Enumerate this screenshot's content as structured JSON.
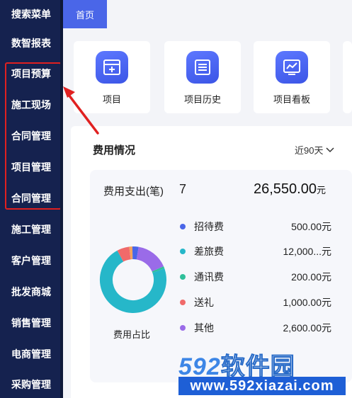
{
  "sidebar": {
    "items": [
      {
        "label": "搜索菜单"
      },
      {
        "label": "数智报表"
      },
      {
        "label": "项目预算"
      },
      {
        "label": "施工现场"
      },
      {
        "label": "合同管理"
      },
      {
        "label": "项目管理"
      },
      {
        "label": "合同管理"
      },
      {
        "label": "施工管理"
      },
      {
        "label": "客户管理"
      },
      {
        "label": "批发商城"
      },
      {
        "label": "销售管理"
      },
      {
        "label": "电商管理"
      },
      {
        "label": "采购管理"
      }
    ]
  },
  "topbar": {
    "home_tab": "首页"
  },
  "quick_cards": [
    {
      "label": "项目",
      "icon": "project-add-icon"
    },
    {
      "label": "项目历史",
      "icon": "project-history-icon"
    },
    {
      "label": "项目看板",
      "icon": "project-dashboard-icon"
    }
  ],
  "expenses": {
    "title": "费用情况",
    "period": "近90天",
    "count_label": "费用支出(笔)",
    "count": "7",
    "total": "26,550.00",
    "total_unit": "元",
    "donut_caption": "费用占比",
    "items": [
      {
        "name": "招待费",
        "amount": "500.00元",
        "color": "#4a66e8"
      },
      {
        "name": "差旅费",
        "amount": "12,000...元",
        "color": "#26b7c9"
      },
      {
        "name": "通讯费",
        "amount": "200.00元",
        "color": "#2fbf9a"
      },
      {
        "name": "送礼",
        "amount": "1,000.00元",
        "color": "#f06a6a"
      },
      {
        "name": "其他",
        "amount": "2,600.00元",
        "color": "#9a6be8"
      }
    ],
    "donut_segments": [
      {
        "color": "#26b7c9",
        "value": 12000
      },
      {
        "color": "#f06a6a",
        "value": 1000
      },
      {
        "color": "#f5a35c",
        "value": 250
      },
      {
        "color": "#4a66e8",
        "value": 500
      },
      {
        "color": "#9a6be8",
        "value": 2600
      },
      {
        "color": "#2fbf9a",
        "value": 200
      }
    ]
  },
  "watermark": {
    "brand": "592",
    "brand_cn": "软件园",
    "url": "www.592xiazai.com"
  },
  "colors": {
    "sidebar_bg": "#15224f",
    "accent": "#4a66e8",
    "highlight": "#e02020"
  }
}
